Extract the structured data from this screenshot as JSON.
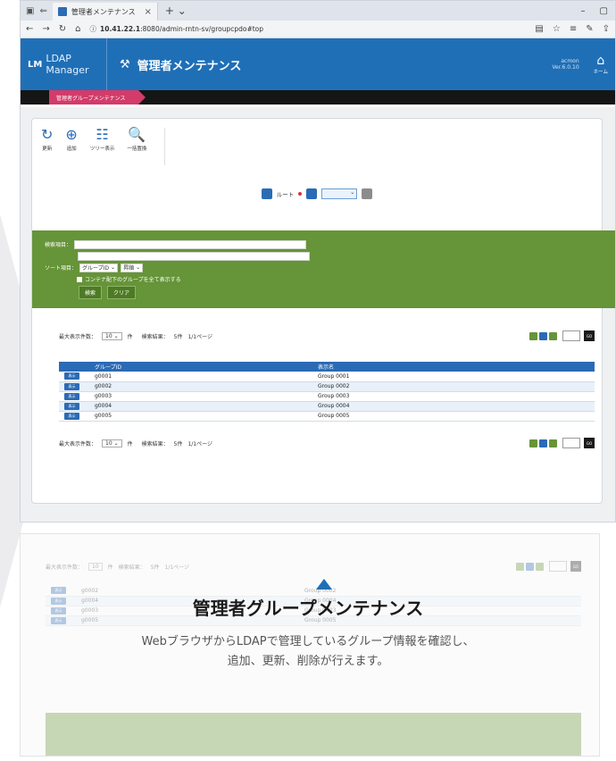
{
  "browser": {
    "tab_title": "管理者メンテナンス",
    "url_host": "10.41.22.1",
    "url_rest": ":8080/admin-rntn-sv/groupcpdo#top"
  },
  "app": {
    "logo_text": "LDAP Manager",
    "logo_mark": "LM",
    "title": "管理者メンテナンス",
    "user": "acmon",
    "version": "Ver.6.0.10",
    "home_label": "ホーム"
  },
  "breadcrumb": "管理者グループメンテナンス",
  "toolbar": [
    {
      "label": "更新",
      "icon": "refresh-icon"
    },
    {
      "label": "追加",
      "icon": "add-icon"
    },
    {
      "label": "ツリー表示",
      "icon": "tree-icon"
    },
    {
      "label": "一括置換",
      "icon": "search-replace-icon"
    }
  ],
  "root": {
    "label": "ルート"
  },
  "search": {
    "item_label": "検索項目：",
    "sort_label": "ソート項目：",
    "sort_field": "グループID",
    "sort_order": "昇順",
    "subgroup_label": "コンテナ配下のグループを全て表示する",
    "search_button": "検索",
    "clear_button": "クリア"
  },
  "pager": {
    "max_label": "最大表示件数：",
    "max_value": "10",
    "per_unit": "件",
    "result_label": "検索結果：",
    "result_value": "5件",
    "page_value": "1/1ページ",
    "go_label": "GO"
  },
  "table": {
    "headers": [
      "グループID",
      "表示名"
    ],
    "row_button": "表示",
    "rows": [
      {
        "id": "g0001",
        "name": "Group 0001"
      },
      {
        "id": "g0002",
        "name": "Group 0002"
      },
      {
        "id": "g0003",
        "name": "Group 0003"
      },
      {
        "id": "g0004",
        "name": "Group 0004"
      },
      {
        "id": "g0005",
        "name": "Group 0005"
      }
    ]
  },
  "lower_rows": [
    {
      "id": "g0002",
      "name": "Group 0002"
    },
    {
      "id": "g0004",
      "name": "Group 0004"
    },
    {
      "id": "g0003",
      "name": "Group 0003"
    },
    {
      "id": "g0005",
      "name": "Group 0005"
    }
  ],
  "caption": {
    "title": "管理者グループメンテナンス",
    "line1": "WebブラウザからLDAPで管理しているグループ情報を確認し、",
    "line2": "追加、更新、削除が行えます。"
  },
  "colors": {
    "accent": "#1f6fb7",
    "green": "#669438",
    "crumb": "#d33b6a"
  }
}
